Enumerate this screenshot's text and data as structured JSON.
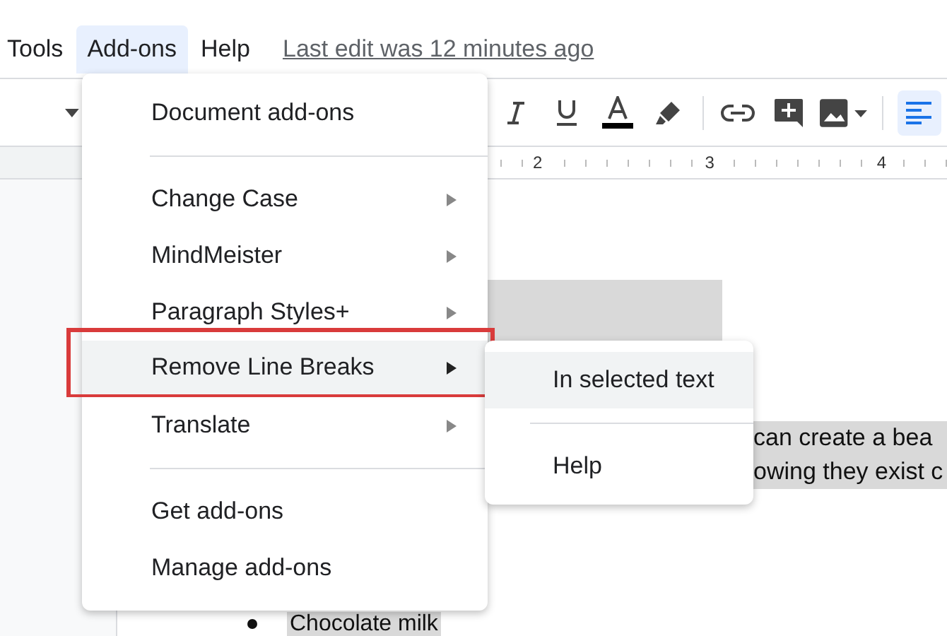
{
  "menubar": {
    "items": [
      {
        "label": "Tools",
        "selected": false
      },
      {
        "label": "Add-ons",
        "selected": true
      },
      {
        "label": "Help",
        "selected": false
      }
    ],
    "last_edit": "Last edit was 12 minutes ago"
  },
  "toolbar": {
    "buttons": [
      {
        "kind": "caret"
      },
      {
        "kind": "italic"
      },
      {
        "kind": "underline"
      },
      {
        "kind": "text-color"
      },
      {
        "kind": "highlight"
      },
      {
        "kind": "divider"
      },
      {
        "kind": "link"
      },
      {
        "kind": "comment"
      },
      {
        "kind": "image"
      },
      {
        "kind": "divider"
      }
    ],
    "align_left_active": true
  },
  "ruler": {
    "numbers": [
      "2",
      "3",
      "4"
    ]
  },
  "document": {
    "lines": [
      "can create a bea",
      "owing they exist c"
    ],
    "bullets": [
      "Chocolate milk"
    ]
  },
  "menu": {
    "items": [
      {
        "kind": "item",
        "label": "Document add-ons",
        "submenu": false,
        "highlighted": false,
        "outlined": false
      },
      {
        "kind": "divider"
      },
      {
        "kind": "item",
        "label": "Change Case",
        "submenu": true,
        "highlighted": false,
        "outlined": false
      },
      {
        "kind": "item",
        "label": "MindMeister",
        "submenu": true,
        "highlighted": false,
        "outlined": false
      },
      {
        "kind": "item",
        "label": "Paragraph Styles+",
        "submenu": true,
        "highlighted": false,
        "outlined": false
      },
      {
        "kind": "item",
        "label": "Remove Line Breaks",
        "submenu": true,
        "highlighted": true,
        "outlined": true
      },
      {
        "kind": "item",
        "label": "Translate",
        "submenu": true,
        "highlighted": false,
        "outlined": false
      },
      {
        "kind": "divider"
      },
      {
        "kind": "item",
        "label": "Get add-ons",
        "submenu": false,
        "highlighted": false,
        "outlined": false
      },
      {
        "kind": "item",
        "label": "Manage add-ons",
        "submenu": false,
        "highlighted": false,
        "outlined": false
      }
    ]
  },
  "submenu": {
    "items": [
      {
        "kind": "item",
        "label": "In selected text",
        "highlighted": true
      },
      {
        "kind": "divider"
      },
      {
        "kind": "item",
        "label": "Help",
        "highlighted": false
      }
    ]
  }
}
